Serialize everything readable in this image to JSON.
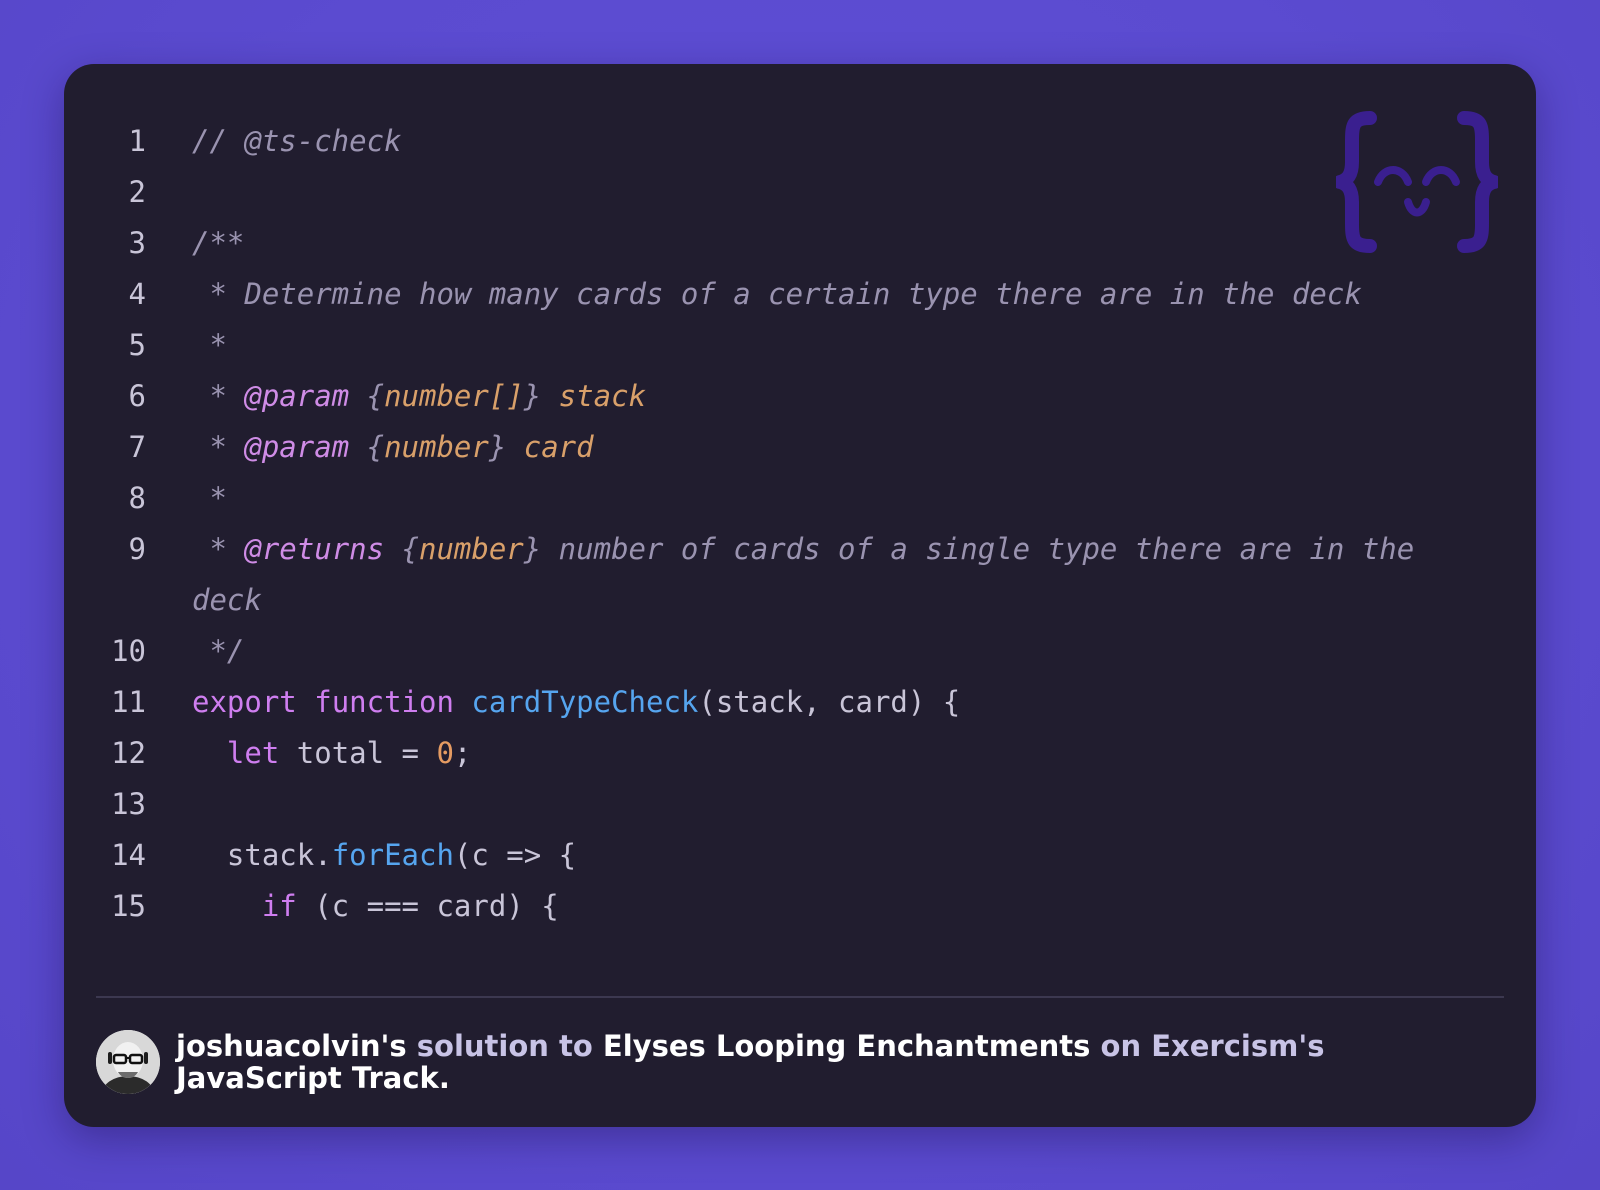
{
  "code": {
    "lines": [
      {
        "number": "1",
        "parts": [
          {
            "t": "// @ts-check",
            "c": "cm"
          }
        ]
      },
      {
        "number": "2",
        "parts": []
      },
      {
        "number": "3",
        "parts": [
          {
            "t": "/**",
            "c": "cm"
          }
        ]
      },
      {
        "number": "4",
        "parts": [
          {
            "t": " * Determine how many cards of a certain type there are in the deck",
            "c": "cm"
          }
        ]
      },
      {
        "number": "5",
        "parts": [
          {
            "t": " *",
            "c": "cm"
          }
        ]
      },
      {
        "number": "6",
        "parts": [
          {
            "t": " * ",
            "c": "cm"
          },
          {
            "t": "@param",
            "c": "tag"
          },
          {
            "t": " {",
            "c": "cm"
          },
          {
            "t": "number[]",
            "c": "typ"
          },
          {
            "t": "} ",
            "c": "cm"
          },
          {
            "t": "stack",
            "c": "typ"
          }
        ]
      },
      {
        "number": "7",
        "parts": [
          {
            "t": " * ",
            "c": "cm"
          },
          {
            "t": "@param",
            "c": "tag"
          },
          {
            "t": " {",
            "c": "cm"
          },
          {
            "t": "number",
            "c": "typ"
          },
          {
            "t": "} ",
            "c": "cm"
          },
          {
            "t": "card",
            "c": "typ"
          }
        ]
      },
      {
        "number": "8",
        "parts": [
          {
            "t": " *",
            "c": "cm"
          }
        ]
      },
      {
        "number": "9",
        "parts": [
          {
            "t": " * ",
            "c": "cm"
          },
          {
            "t": "@returns",
            "c": "tag"
          },
          {
            "t": " {",
            "c": "cm"
          },
          {
            "t": "number",
            "c": "typ"
          },
          {
            "t": "} number of cards of a single type there are in the deck",
            "c": "cm"
          }
        ]
      },
      {
        "number": "10",
        "parts": [
          {
            "t": " */",
            "c": "cm"
          }
        ]
      },
      {
        "number": "11",
        "parts": [
          {
            "t": "export",
            "c": "kw"
          },
          {
            "t": " ",
            "c": "pl"
          },
          {
            "t": "function",
            "c": "kw"
          },
          {
            "t": " ",
            "c": "pl"
          },
          {
            "t": "cardTypeCheck",
            "c": "fn"
          },
          {
            "t": "(stack, card) {",
            "c": "pl"
          }
        ]
      },
      {
        "number": "12",
        "parts": [
          {
            "t": "  ",
            "c": "pl"
          },
          {
            "t": "let",
            "c": "kw"
          },
          {
            "t": " total = ",
            "c": "pl"
          },
          {
            "t": "0",
            "c": "num"
          },
          {
            "t": ";",
            "c": "pl"
          }
        ]
      },
      {
        "number": "13",
        "parts": []
      },
      {
        "number": "14",
        "parts": [
          {
            "t": "  stack.",
            "c": "pl"
          },
          {
            "t": "forEach",
            "c": "fn"
          },
          {
            "t": "(c => {",
            "c": "pl"
          }
        ]
      },
      {
        "number": "15",
        "parts": [
          {
            "t": "    ",
            "c": "pl"
          },
          {
            "t": "if",
            "c": "kw"
          },
          {
            "t": " (c === card) {",
            "c": "pl"
          }
        ]
      }
    ]
  },
  "footer": {
    "author": "joshuacolvin's",
    "solution_to": "solution to",
    "exercise": "Elyses Looping Enchantments",
    "on": "on",
    "site": "Exercism's",
    "track": "JavaScript Track."
  },
  "colors": {
    "background": "#5b4bd0",
    "card": "#211d2f",
    "comment": "#9a93b0",
    "keyword": "#cf7ef0",
    "function": "#56a5ef",
    "number": "#e59b62",
    "type": "#d9a06a"
  },
  "icons": {
    "logo": "exercism-logo-icon",
    "avatar": "user-avatar"
  }
}
